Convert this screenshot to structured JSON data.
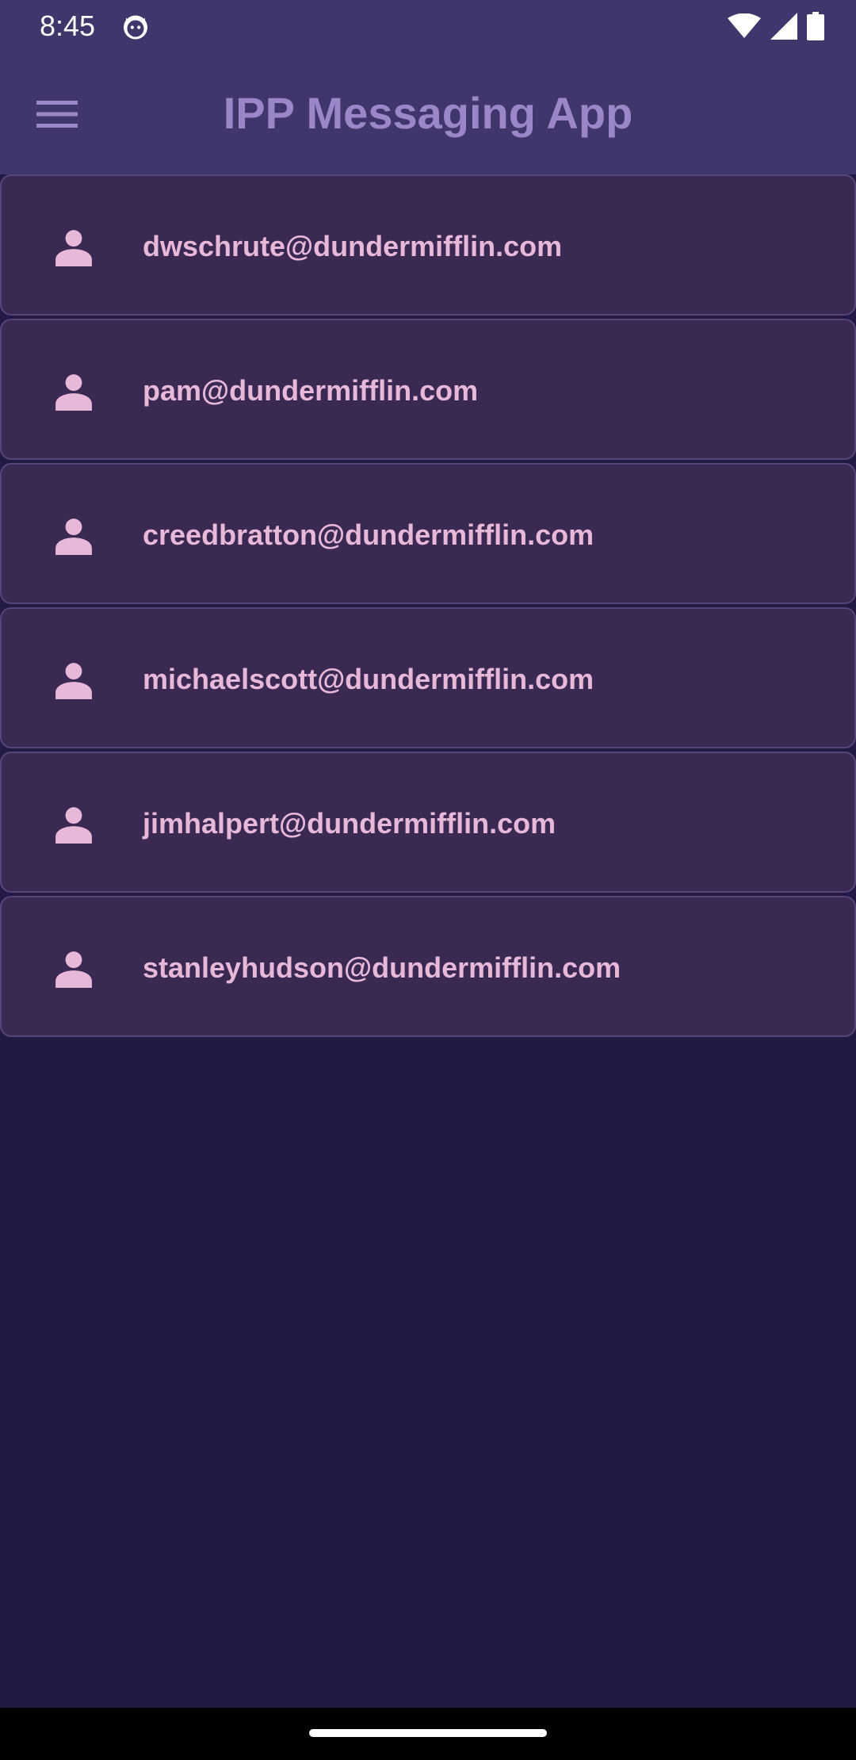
{
  "status_bar": {
    "time": "8:45",
    "icons": [
      "cat-notification-icon",
      "wifi-icon",
      "cell-signal-icon",
      "battery-icon"
    ]
  },
  "app_bar": {
    "title": "IPP Messaging App",
    "menu_icon": "hamburger-menu-icon"
  },
  "contacts": [
    {
      "email": "dwschrute@dundermifflin.com",
      "icon": "person-icon"
    },
    {
      "email": "pam@dundermifflin.com",
      "icon": "person-icon"
    },
    {
      "email": "creedbratton@dundermifflin.com",
      "icon": "person-icon"
    },
    {
      "email": "michaelscott@dundermifflin.com",
      "icon": "person-icon"
    },
    {
      "email": "jimhalpert@dundermifflin.com",
      "icon": "person-icon"
    },
    {
      "email": "stanleyhudson@dundermifflin.com",
      "icon": "person-icon"
    }
  ],
  "colors": {
    "app_bar": "#40366b",
    "background": "#231a44",
    "card": "#3a2953",
    "card_border": "#55457a",
    "title": "#9b86c8",
    "contact_text": "#e8b8d8"
  }
}
